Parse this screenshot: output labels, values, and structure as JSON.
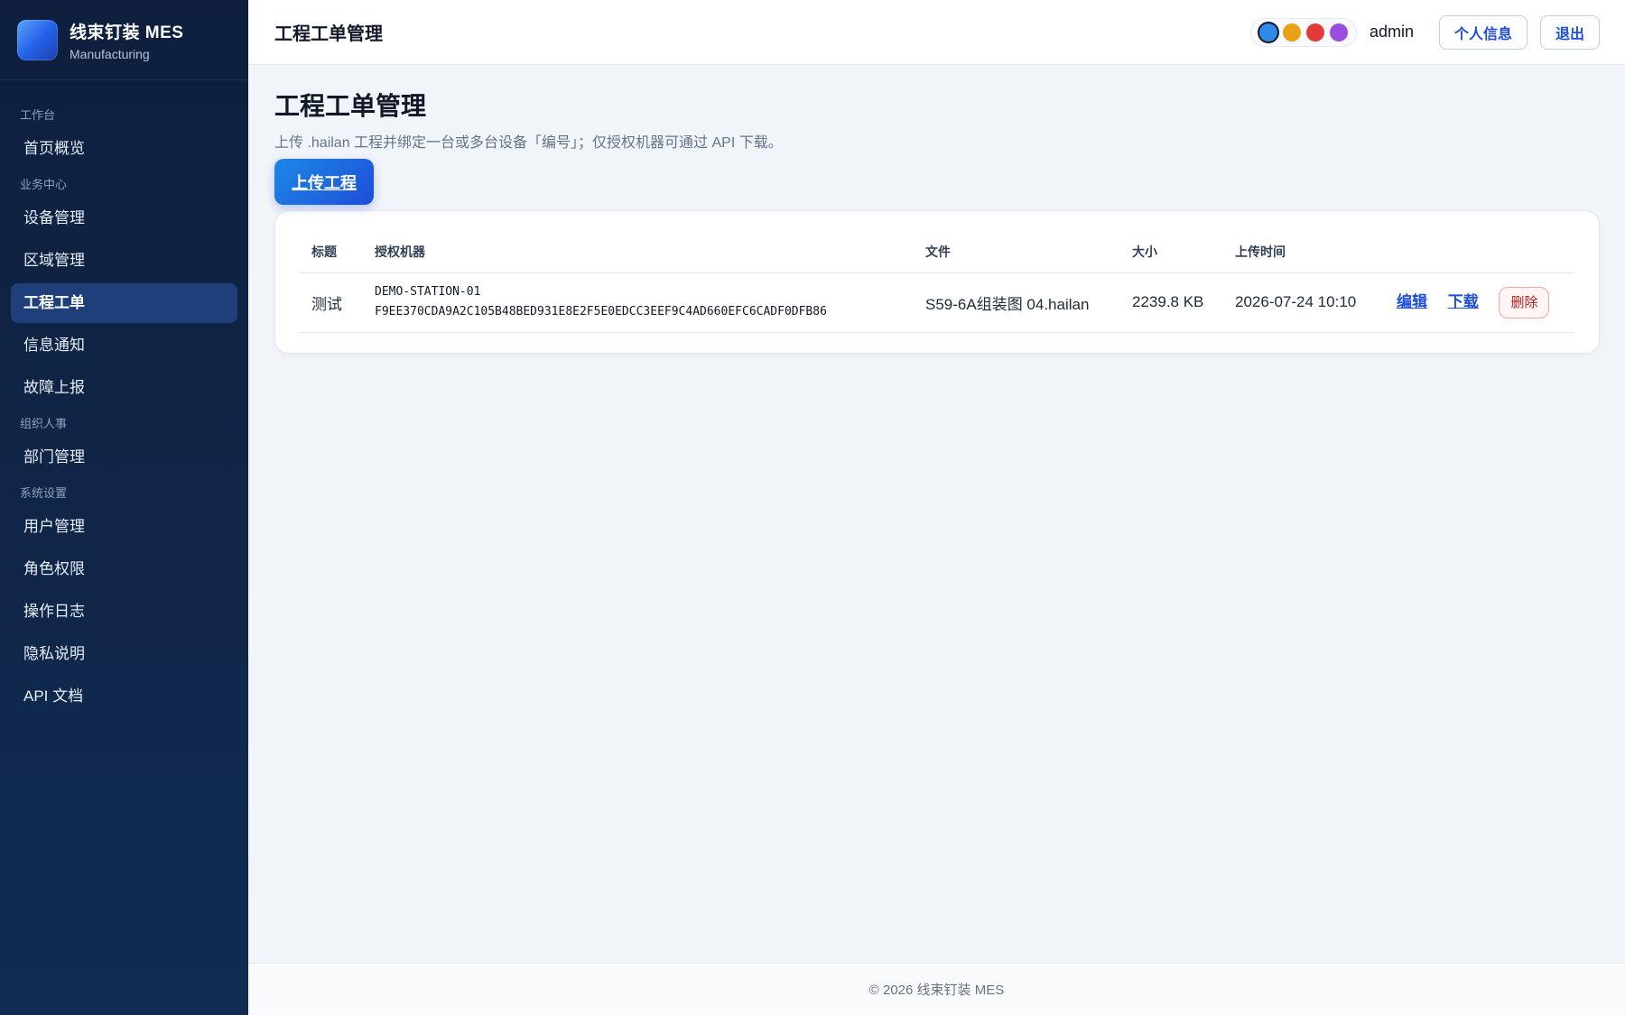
{
  "brand": {
    "name": "线束钉装 MES",
    "sub": "Manufacturing"
  },
  "sidebar": {
    "groups": [
      {
        "label": "工作台",
        "items": [
          {
            "label": "首页概览"
          }
        ]
      },
      {
        "label": "业务中心",
        "items": [
          {
            "label": "设备管理"
          },
          {
            "label": "区域管理"
          },
          {
            "label": "工程工单",
            "active": true
          },
          {
            "label": "信息通知"
          },
          {
            "label": "故障上报"
          }
        ]
      },
      {
        "label": "组织人事",
        "items": [
          {
            "label": "部门管理"
          }
        ]
      },
      {
        "label": "系统设置",
        "items": [
          {
            "label": "用户管理"
          },
          {
            "label": "角色权限"
          },
          {
            "label": "操作日志"
          },
          {
            "label": "隐私说明"
          },
          {
            "label": "API 文档"
          }
        ]
      }
    ]
  },
  "header": {
    "title": "工程工单管理",
    "theme_colors": [
      "#2f8ae8",
      "#e8a014",
      "#e23b3b",
      "#9b4de0"
    ],
    "user": "admin",
    "profile_label": "个人信息",
    "logout_label": "退出"
  },
  "main": {
    "title": "工程工单管理",
    "description": "上传 .hailan 工程并绑定一台或多台设备「编号」；仅授权机器可通过 API 下载。",
    "upload_label": "上传工程",
    "table": {
      "columns": [
        "标题",
        "授权机器",
        "文件",
        "大小",
        "上传时间",
        ""
      ],
      "rows": [
        {
          "title": "测试",
          "machine_line1": "DEMO-STATION-01",
          "machine_line2": "F9EE370CDA9A2C105B48BED931E8E2F5E0EDCC3EEF9C4AD660EFC6CADF0DFB86",
          "file": "S59-6A组装图 04.hailan",
          "size": "2239.8 KB",
          "time": "2026-07-24 10:10",
          "edit_label": "编辑",
          "download_label": "下载",
          "delete_label": "删除"
        }
      ]
    }
  },
  "footer": {
    "text": "© 2026 线束钉装 MES"
  }
}
